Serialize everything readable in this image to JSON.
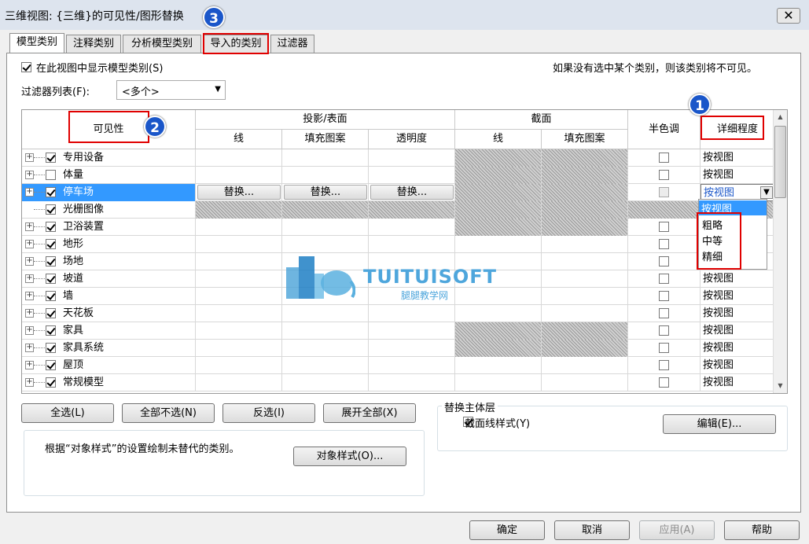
{
  "window": {
    "title": "三维视图: {三维}的可见性/图形替换",
    "close_glyph": "✕"
  },
  "tabs": [
    "模型类别",
    "注释类别",
    "分析模型类别",
    "导入的类别",
    "过滤器"
  ],
  "show_categories_label": "在此视图中显示模型类别(S)",
  "hint_text": "如果没有选中某个类别，则该类别将不可见。",
  "filter_list": {
    "label": "过滤器列表(F):",
    "value": "<多个>"
  },
  "grid": {
    "headers": {
      "visibility": "可见性",
      "projection": "投影/表面",
      "section": "截面",
      "halftone": "半色调",
      "detail": "详细程度",
      "line": "线",
      "fill": "填充图案",
      "transparency": "透明度",
      "sec_line": "线",
      "sec_fill": "填充图案"
    },
    "replace_label": "替换...",
    "rows": [
      {
        "name": "专用设备",
        "checked": true,
        "expandable": true,
        "detail": "按视图",
        "hatch": true
      },
      {
        "name": "体量",
        "checked": false,
        "expandable": true,
        "detail": "按视图",
        "hatch": true
      },
      {
        "name": "停车场",
        "checked": true,
        "expandable": true,
        "detail": "按视图",
        "hatch": true,
        "selected": true
      },
      {
        "name": "光栅图像",
        "checked": true,
        "expandable": false,
        "detail": "",
        "hatch": false,
        "raster": true
      },
      {
        "name": "卫浴装置",
        "checked": true,
        "expandable": true,
        "detail": "",
        "hatch": true
      },
      {
        "name": "地形",
        "checked": true,
        "expandable": true,
        "detail": "",
        "hatch": false
      },
      {
        "name": "场地",
        "checked": true,
        "expandable": true,
        "detail": "",
        "hatch": false
      },
      {
        "name": "坡道",
        "checked": true,
        "expandable": true,
        "detail": "按视图",
        "hatch": false
      },
      {
        "name": "墙",
        "checked": true,
        "expandable": true,
        "detail": "按视图",
        "hatch": false
      },
      {
        "name": "天花板",
        "checked": true,
        "expandable": true,
        "detail": "按视图",
        "hatch": false
      },
      {
        "name": "家具",
        "checked": true,
        "expandable": true,
        "detail": "按视图",
        "hatch": true
      },
      {
        "name": "家具系统",
        "checked": true,
        "expandable": true,
        "detail": "按视图",
        "hatch": true
      },
      {
        "name": "屋顶",
        "checked": true,
        "expandable": true,
        "detail": "按视图",
        "hatch": false
      },
      {
        "name": "常规模型",
        "checked": true,
        "expandable": true,
        "detail": "按视图",
        "hatch": false
      }
    ]
  },
  "detail_dropdown": {
    "options": [
      "按视图",
      "粗略",
      "中等",
      "精细"
    ],
    "selected": "按视图",
    "arrow": "▼"
  },
  "buttons": {
    "select_all": "全选(L)",
    "select_none": "全部不选(N)",
    "invert": "反选(I)",
    "expand_all": "展开全部(X)",
    "object_styles": "对象样式(O)...",
    "edit": "编辑(E)...",
    "ok": "确定",
    "cancel": "取消",
    "apply": "应用(A)",
    "help": "帮助"
  },
  "object_styles_note": "根据“对象样式”的设置绘制未替代的类别。",
  "host_layers": {
    "title": "替换主体层",
    "cut_line_styles": "截面线样式(Y)"
  },
  "watermark": {
    "brand": "TUITUISOFT",
    "sub": "腿腿教学网"
  },
  "badges": [
    "1",
    "2",
    "3"
  ],
  "colors": {
    "selection": "#3399ff",
    "annotation": "#e00000",
    "badge": "#1a56c9"
  }
}
